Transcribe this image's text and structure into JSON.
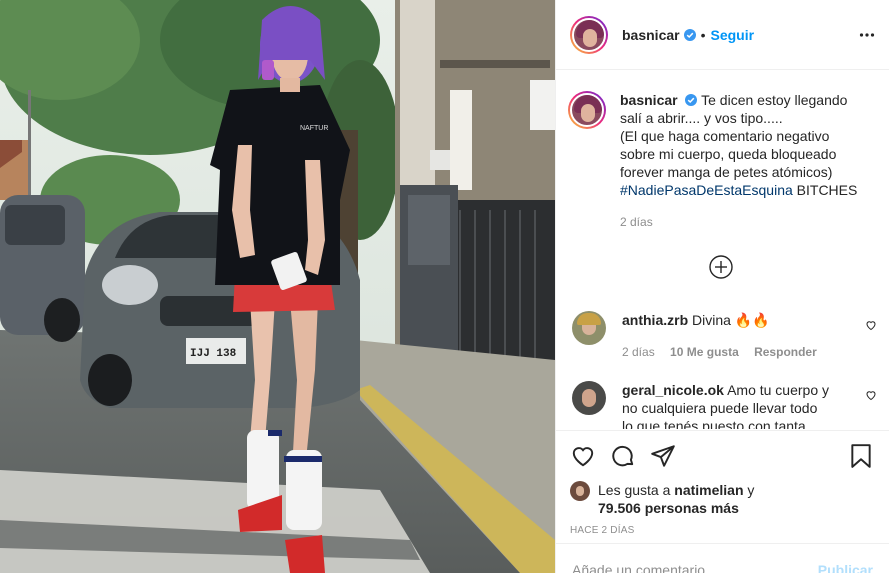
{
  "post": {
    "username": "basnicar",
    "follow_label": "Seguir",
    "separator": "•"
  },
  "caption": {
    "username": "basnicar",
    "line1": "Te dicen estoy llegando",
    "line2": "salí a abrir.... y vos tipo.....",
    "line3": "(El que haga comentario negativo",
    "line4": "sobre mi cuerpo, queda bloqueado",
    "line5": "forever manga de petes atómicos)",
    "hashtag": "#NadiePasaDeEstaEsquina",
    "tail": " BITCHES",
    "time": "2 días"
  },
  "comments": [
    {
      "username": "anthia.zrb",
      "text": "Divina 🔥🔥",
      "time": "2 días",
      "likes": "10 Me gusta",
      "reply": "Responder"
    },
    {
      "username": "geral_nicole.ok",
      "text1": "Amo tu cuerpo y",
      "text2": "no cualquiera puede llevar todo",
      "text3": "lo que tenés puesto con tanta"
    }
  ],
  "likes": {
    "prefix": "Les gusta a ",
    "liker": "natimelian",
    "suffix": " y",
    "count": "79.506 personas más"
  },
  "time_ago": "HACE 2 DÍAS",
  "add_comment": {
    "placeholder": "Añade un comentario...",
    "post_label": "Publicar"
  },
  "colors": {
    "accent": "#0095f6",
    "hashtag": "#00376b",
    "muted": "#8e8e8e",
    "verified": "#3897f0"
  }
}
